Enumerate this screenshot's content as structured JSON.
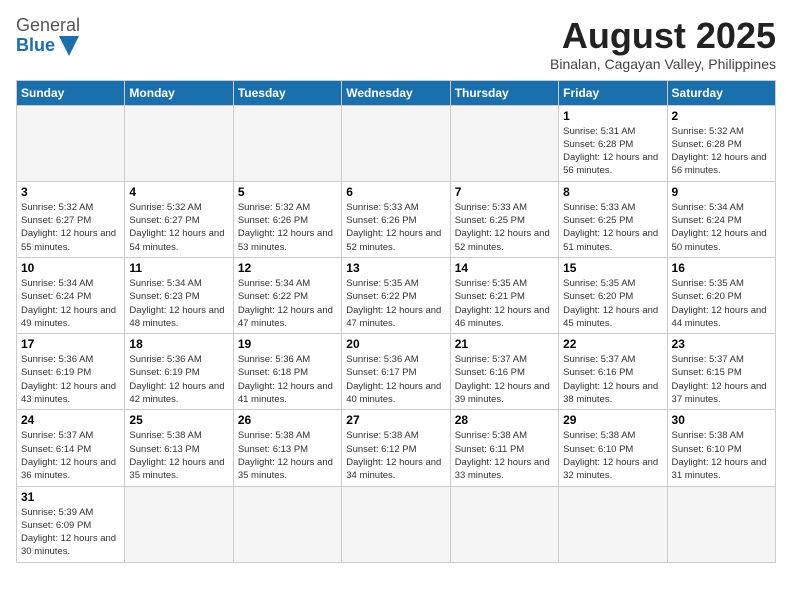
{
  "logo": {
    "general": "General",
    "blue": "Blue",
    "icon_color": "#1a6faf"
  },
  "header": {
    "title": "August 2025",
    "subtitle": "Binalan, Cagayan Valley, Philippines"
  },
  "weekdays": [
    "Sunday",
    "Monday",
    "Tuesday",
    "Wednesday",
    "Thursday",
    "Friday",
    "Saturday"
  ],
  "weeks": [
    {
      "days": [
        {
          "num": "",
          "info": ""
        },
        {
          "num": "",
          "info": ""
        },
        {
          "num": "",
          "info": ""
        },
        {
          "num": "",
          "info": ""
        },
        {
          "num": "",
          "info": ""
        },
        {
          "num": "1",
          "info": "Sunrise: 5:31 AM\nSunset: 6:28 PM\nDaylight: 12 hours and 56 minutes."
        },
        {
          "num": "2",
          "info": "Sunrise: 5:32 AM\nSunset: 6:28 PM\nDaylight: 12 hours and 56 minutes."
        }
      ]
    },
    {
      "days": [
        {
          "num": "3",
          "info": "Sunrise: 5:32 AM\nSunset: 6:27 PM\nDaylight: 12 hours and 55 minutes."
        },
        {
          "num": "4",
          "info": "Sunrise: 5:32 AM\nSunset: 6:27 PM\nDaylight: 12 hours and 54 minutes."
        },
        {
          "num": "5",
          "info": "Sunrise: 5:32 AM\nSunset: 6:26 PM\nDaylight: 12 hours and 53 minutes."
        },
        {
          "num": "6",
          "info": "Sunrise: 5:33 AM\nSunset: 6:26 PM\nDaylight: 12 hours and 52 minutes."
        },
        {
          "num": "7",
          "info": "Sunrise: 5:33 AM\nSunset: 6:25 PM\nDaylight: 12 hours and 52 minutes."
        },
        {
          "num": "8",
          "info": "Sunrise: 5:33 AM\nSunset: 6:25 PM\nDaylight: 12 hours and 51 minutes."
        },
        {
          "num": "9",
          "info": "Sunrise: 5:34 AM\nSunset: 6:24 PM\nDaylight: 12 hours and 50 minutes."
        }
      ]
    },
    {
      "days": [
        {
          "num": "10",
          "info": "Sunrise: 5:34 AM\nSunset: 6:24 PM\nDaylight: 12 hours and 49 minutes."
        },
        {
          "num": "11",
          "info": "Sunrise: 5:34 AM\nSunset: 6:23 PM\nDaylight: 12 hours and 48 minutes."
        },
        {
          "num": "12",
          "info": "Sunrise: 5:34 AM\nSunset: 6:22 PM\nDaylight: 12 hours and 47 minutes."
        },
        {
          "num": "13",
          "info": "Sunrise: 5:35 AM\nSunset: 6:22 PM\nDaylight: 12 hours and 47 minutes."
        },
        {
          "num": "14",
          "info": "Sunrise: 5:35 AM\nSunset: 6:21 PM\nDaylight: 12 hours and 46 minutes."
        },
        {
          "num": "15",
          "info": "Sunrise: 5:35 AM\nSunset: 6:20 PM\nDaylight: 12 hours and 45 minutes."
        },
        {
          "num": "16",
          "info": "Sunrise: 5:35 AM\nSunset: 6:20 PM\nDaylight: 12 hours and 44 minutes."
        }
      ]
    },
    {
      "days": [
        {
          "num": "17",
          "info": "Sunrise: 5:36 AM\nSunset: 6:19 PM\nDaylight: 12 hours and 43 minutes."
        },
        {
          "num": "18",
          "info": "Sunrise: 5:36 AM\nSunset: 6:19 PM\nDaylight: 12 hours and 42 minutes."
        },
        {
          "num": "19",
          "info": "Sunrise: 5:36 AM\nSunset: 6:18 PM\nDaylight: 12 hours and 41 minutes."
        },
        {
          "num": "20",
          "info": "Sunrise: 5:36 AM\nSunset: 6:17 PM\nDaylight: 12 hours and 40 minutes."
        },
        {
          "num": "21",
          "info": "Sunrise: 5:37 AM\nSunset: 6:16 PM\nDaylight: 12 hours and 39 minutes."
        },
        {
          "num": "22",
          "info": "Sunrise: 5:37 AM\nSunset: 6:16 PM\nDaylight: 12 hours and 38 minutes."
        },
        {
          "num": "23",
          "info": "Sunrise: 5:37 AM\nSunset: 6:15 PM\nDaylight: 12 hours and 37 minutes."
        }
      ]
    },
    {
      "days": [
        {
          "num": "24",
          "info": "Sunrise: 5:37 AM\nSunset: 6:14 PM\nDaylight: 12 hours and 36 minutes."
        },
        {
          "num": "25",
          "info": "Sunrise: 5:38 AM\nSunset: 6:13 PM\nDaylight: 12 hours and 35 minutes."
        },
        {
          "num": "26",
          "info": "Sunrise: 5:38 AM\nSunset: 6:13 PM\nDaylight: 12 hours and 35 minutes."
        },
        {
          "num": "27",
          "info": "Sunrise: 5:38 AM\nSunset: 6:12 PM\nDaylight: 12 hours and 34 minutes."
        },
        {
          "num": "28",
          "info": "Sunrise: 5:38 AM\nSunset: 6:11 PM\nDaylight: 12 hours and 33 minutes."
        },
        {
          "num": "29",
          "info": "Sunrise: 5:38 AM\nSunset: 6:10 PM\nDaylight: 12 hours and 32 minutes."
        },
        {
          "num": "30",
          "info": "Sunrise: 5:38 AM\nSunset: 6:10 PM\nDaylight: 12 hours and 31 minutes."
        }
      ]
    },
    {
      "days": [
        {
          "num": "31",
          "info": "Sunrise: 5:39 AM\nSunset: 6:09 PM\nDaylight: 12 hours and 30 minutes."
        },
        {
          "num": "",
          "info": ""
        },
        {
          "num": "",
          "info": ""
        },
        {
          "num": "",
          "info": ""
        },
        {
          "num": "",
          "info": ""
        },
        {
          "num": "",
          "info": ""
        },
        {
          "num": "",
          "info": ""
        }
      ]
    }
  ]
}
